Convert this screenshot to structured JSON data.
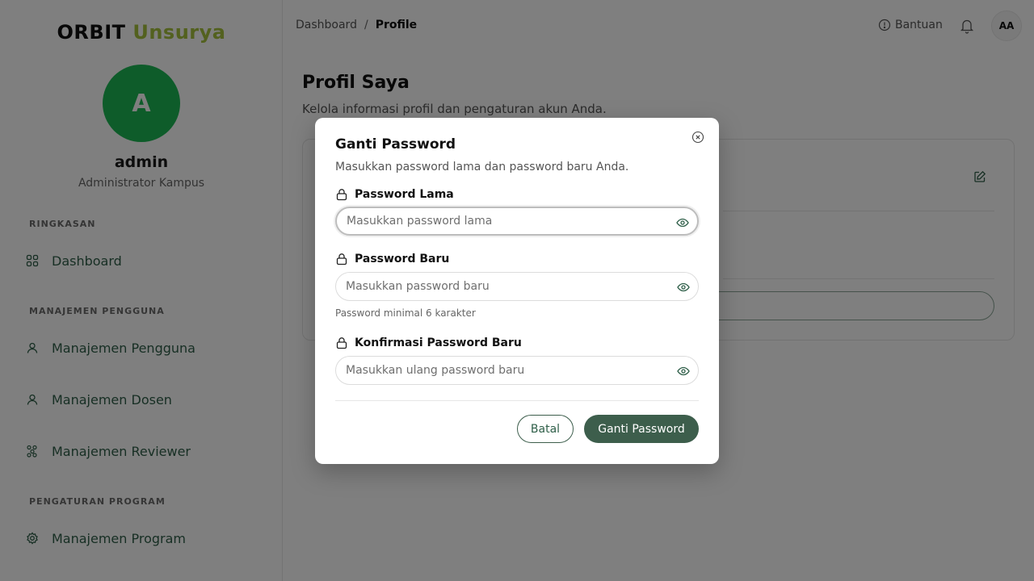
{
  "sidebar": {
    "brand_part1": "ORBIT",
    "brand_part2": "Unsurya",
    "avatar_letter": "A",
    "user_name": "admin",
    "user_role": "Administrator Kampus",
    "sections": [
      {
        "label": "RINGKASAN"
      },
      {
        "label": "MANAJEMEN PENGGUNA"
      },
      {
        "label": "PENGATURAN PROGRAM"
      }
    ],
    "items": [
      {
        "label": "Dashboard",
        "icon": "grid-icon"
      },
      {
        "label": "Manajemen Pengguna",
        "icon": "user-icon"
      },
      {
        "label": "Manajemen Dosen",
        "icon": "user-icon"
      },
      {
        "label": "Manajemen Reviewer",
        "icon": "network-icon"
      },
      {
        "label": "Manajemen Program",
        "icon": "gear-icon"
      }
    ]
  },
  "header": {
    "breadcrumb_root": "Dashboard",
    "breadcrumb_sep": "/",
    "breadcrumb_current": "Profile",
    "help_label": "Bantuan",
    "avatar_initials": "AA"
  },
  "main": {
    "title": "Profil Saya",
    "subtitle": "Kelola informasi profil dan pengaturan akun Anda."
  },
  "modal": {
    "title": "Ganti Password",
    "description": "Masukkan password lama dan password baru Anda.",
    "fields": [
      {
        "label": "Password Lama",
        "placeholder": "Masukkan password lama",
        "value": ""
      },
      {
        "label": "Password Baru",
        "placeholder": "Masukkan password baru",
        "value": ""
      },
      {
        "label": "Konfirmasi Password Baru",
        "placeholder": "Masukkan ulang password baru",
        "value": ""
      }
    ],
    "hint": "Password minimal 6 karakter",
    "cancel_label": "Batal",
    "submit_label": "Ganti Password"
  },
  "colors": {
    "accent": "#3d5e4c",
    "brand_highlight": "#a6c23f",
    "avatar_bg": "#1db954",
    "nav_text": "#2f5f49"
  }
}
